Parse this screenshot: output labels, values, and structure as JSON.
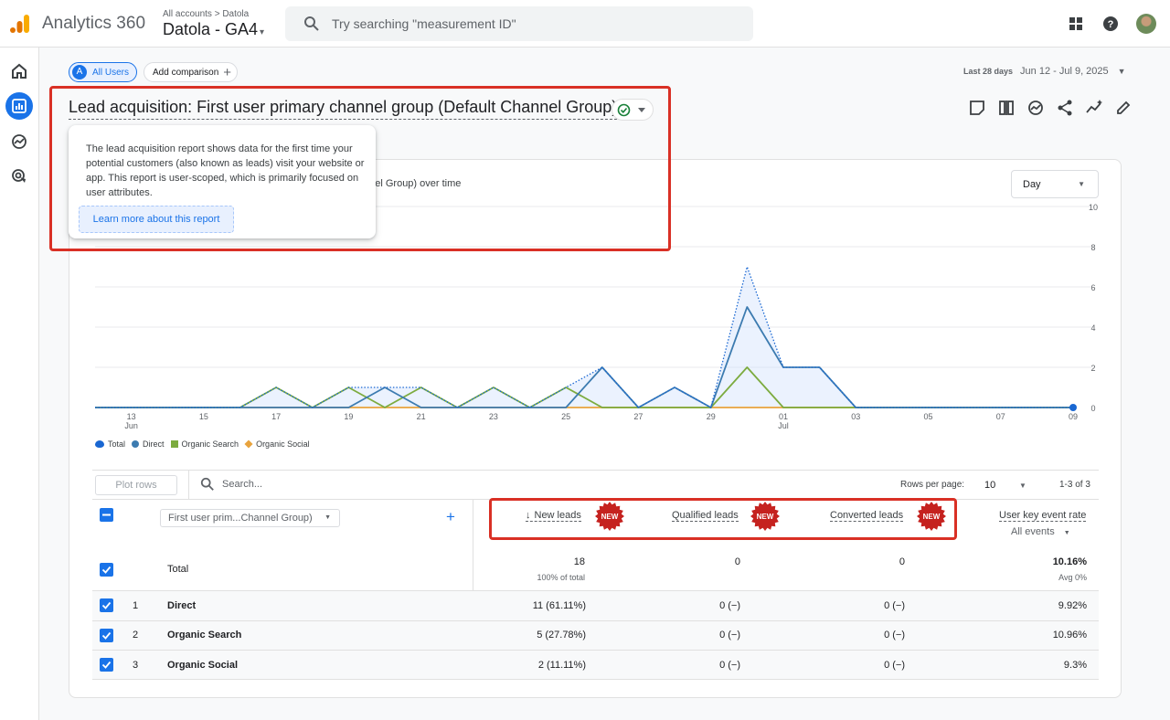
{
  "app": {
    "name": "Analytics 360",
    "breadcrumb": "All accounts > Datola",
    "property": "Datola - GA4",
    "property_caret": "▾"
  },
  "search": {
    "placeholder": "Try searching \"measurement ID\""
  },
  "topbar_icons": [
    "apps-grid-icon",
    "help-icon",
    "account-avatar"
  ],
  "rail": [
    "home-icon",
    "reports-icon",
    "explore-icon",
    "advertising-icon"
  ],
  "comparison": {
    "segment_badge": "A",
    "segment": "All Users",
    "add_label": "Add comparison"
  },
  "date": {
    "label": "Last 28 days",
    "range": "Jun 12 - Jul 9, 2025"
  },
  "report": {
    "title": "Lead acquisition: First user primary channel group (Default Channel Group)"
  },
  "tooltip": {
    "text": "The lead acquisition report shows data for the first time your potential customers (also known as leads) visit your website or app. This report is user-scoped, which is primarily focused on user attributes.",
    "link": "Learn more about this report"
  },
  "chart": {
    "title": "nnel Group) over time",
    "granularity": "Day"
  },
  "chart_data": {
    "type": "line",
    "x": [
      "Jun 12",
      "Jun 13",
      "Jun 14",
      "Jun 15",
      "Jun 16",
      "Jun 17",
      "Jun 18",
      "Jun 19",
      "Jun 20",
      "Jun 21",
      "Jun 22",
      "Jun 23",
      "Jun 24",
      "Jun 25",
      "Jun 26",
      "Jun 27",
      "Jun 28",
      "Jun 29",
      "Jun 30",
      "Jul 1",
      "Jul 2",
      "Jul 3",
      "Jul 4",
      "Jul 5",
      "Jul 6",
      "Jul 7",
      "Jul 8",
      "Jul 9"
    ],
    "x_tick_labels": [
      {
        "top": "13",
        "bottom": "Jun",
        "index": 1
      },
      {
        "top": "15",
        "index": 3
      },
      {
        "top": "17",
        "index": 5
      },
      {
        "top": "19",
        "index": 7
      },
      {
        "top": "21",
        "index": 9
      },
      {
        "top": "23",
        "index": 11
      },
      {
        "top": "25",
        "index": 13
      },
      {
        "top": "27",
        "index": 15
      },
      {
        "top": "29",
        "index": 17
      },
      {
        "top": "01",
        "bottom": "Jul",
        "index": 19
      },
      {
        "top": "03",
        "index": 21
      },
      {
        "top": "05",
        "index": 23
      },
      {
        "top": "07",
        "index": 25
      },
      {
        "top": "09",
        "index": 27
      }
    ],
    "y_ticks": [
      "0",
      "2",
      "4",
      "6",
      "8",
      "10"
    ],
    "ylim": [
      0,
      10
    ],
    "series": [
      {
        "name": "Total",
        "color": "#1967d2",
        "style": "dotted",
        "values": [
          0,
          0,
          0,
          0,
          0,
          1,
          0,
          1,
          1,
          1,
          0,
          1,
          0,
          1,
          2,
          0,
          1,
          0,
          7,
          2,
          2,
          0,
          0,
          0,
          0,
          0,
          0,
          0
        ]
      },
      {
        "name": "Direct",
        "color": "#3c7bb0",
        "values": [
          0,
          0,
          0,
          0,
          0,
          0,
          0,
          0,
          1,
          0,
          0,
          0,
          0,
          0,
          2,
          0,
          1,
          0,
          5,
          2,
          2,
          0,
          0,
          0,
          0,
          0,
          0,
          0
        ]
      },
      {
        "name": "Organic Search",
        "color": "#7cab3f",
        "values": [
          0,
          0,
          0,
          0,
          0,
          1,
          0,
          1,
          0,
          1,
          0,
          1,
          0,
          1,
          0,
          0,
          0,
          0,
          2,
          0,
          0,
          0,
          0,
          0,
          0,
          0,
          0,
          0
        ]
      },
      {
        "name": "Organic Social",
        "color": "#e8a33d",
        "values": [
          0,
          0,
          0,
          0,
          0,
          0,
          0,
          0,
          0,
          0,
          0,
          0,
          0,
          0,
          0,
          0,
          0,
          0,
          0,
          0,
          0,
          0,
          0,
          0,
          0,
          0,
          0,
          0
        ]
      }
    ],
    "legend": [
      "Total",
      "Direct",
      "Organic Search",
      "Organic Social"
    ]
  },
  "table": {
    "plot_rows": "Plot rows",
    "search_placeholder": "Search...",
    "rows_per_page_label": "Rows per page:",
    "rows_per_page": "10",
    "range": "1-3 of 3",
    "dimension": "First user prim...Channel Group)",
    "sort_arrow": "↓",
    "columns": {
      "new_leads": "New leads",
      "qualified_leads": "Qualified leads",
      "converted_leads": "Converted leads",
      "rate": "User key event rate",
      "rate_sub": "All events"
    },
    "badge": "NEW",
    "total": {
      "label": "Total",
      "new_leads": "18",
      "new_leads_sub": "100% of total",
      "qualified": "0",
      "converted": "0",
      "rate": "10.16%",
      "rate_sub": "Avg 0%"
    },
    "rows": [
      {
        "n": "1",
        "name": "Direct",
        "new_leads": "11 (61.11%)",
        "qualified": "0 (−)",
        "converted": "0 (−)",
        "rate": "9.92%"
      },
      {
        "n": "2",
        "name": "Organic Search",
        "new_leads": "5 (27.78%)",
        "qualified": "0 (−)",
        "converted": "0 (−)",
        "rate": "10.96%"
      },
      {
        "n": "3",
        "name": "Organic Social",
        "new_leads": "2 (11.11%)",
        "qualified": "0 (−)",
        "converted": "0 (−)",
        "rate": "9.3%"
      }
    ]
  },
  "colors": {
    "accent": "#1a73e8",
    "highlight": "#d93025",
    "badge": "#c5221f"
  }
}
